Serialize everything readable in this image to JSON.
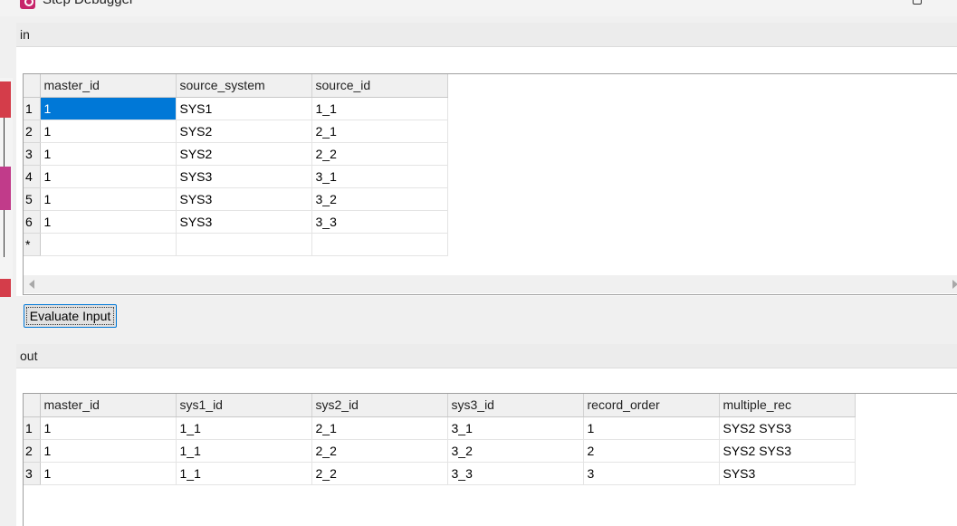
{
  "window": {
    "title": "Step Debugger"
  },
  "in_section": {
    "label": "in",
    "columns": [
      "master_id",
      "source_system",
      "source_id"
    ],
    "rows": [
      {
        "num": "1",
        "cells": [
          "1",
          "SYS1",
          "1_1"
        ]
      },
      {
        "num": "2",
        "cells": [
          "1",
          "SYS2",
          "2_1"
        ]
      },
      {
        "num": "3",
        "cells": [
          "1",
          "SYS2",
          "2_2"
        ]
      },
      {
        "num": "4",
        "cells": [
          "1",
          "SYS3",
          "3_1"
        ]
      },
      {
        "num": "5",
        "cells": [
          "1",
          "SYS3",
          "3_2"
        ]
      },
      {
        "num": "6",
        "cells": [
          "1",
          "SYS3",
          "3_3"
        ]
      }
    ],
    "new_row_marker": "*"
  },
  "evaluate_button": {
    "label": "Evaluate Input"
  },
  "out_section": {
    "label": "out",
    "columns": [
      "master_id",
      "sys1_id",
      "sys2_id",
      "sys3_id",
      "record_order",
      "multiple_rec"
    ],
    "rows": [
      {
        "num": "1",
        "cells": [
          "1",
          "1_1",
          "2_1",
          "3_1",
          "1",
          "SYS2 SYS3"
        ]
      },
      {
        "num": "2",
        "cells": [
          "1",
          "1_1",
          "2_2",
          "3_2",
          "2",
          "SYS2 SYS3"
        ]
      },
      {
        "num": "3",
        "cells": [
          "1",
          "1_1",
          "2_2",
          "3_3",
          "3",
          "SYS3"
        ]
      }
    ]
  },
  "colors": {
    "selection": "#0078d7",
    "node_red": "#d43d4a",
    "app_icon": "#c7246a"
  }
}
